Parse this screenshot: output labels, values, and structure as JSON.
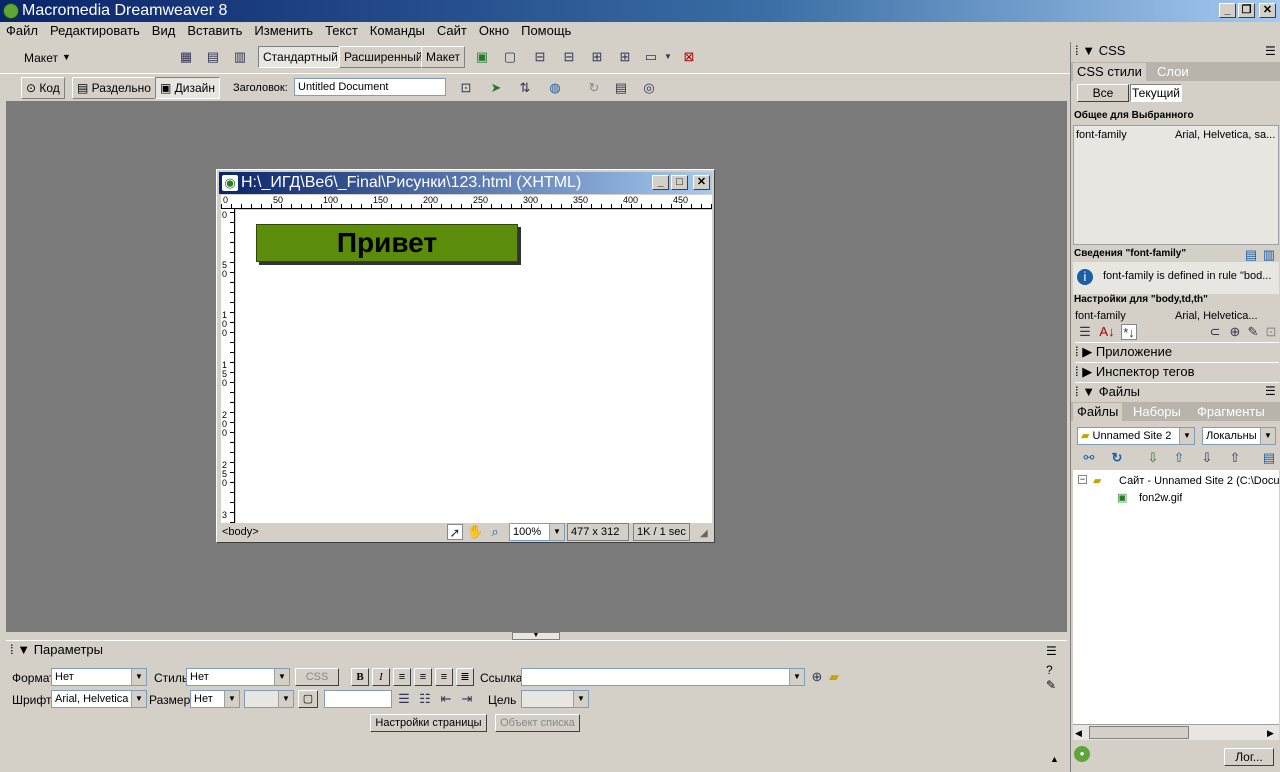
{
  "window": {
    "title": "Macromedia Dreamweaver 8"
  },
  "menu": [
    "Файл",
    "Редактировать",
    "Вид",
    "Вставить",
    "Изменить",
    "Текст",
    "Команды",
    "Сайт",
    "Окно",
    "Помощь"
  ],
  "toolbar": {
    "category": "Макет",
    "modes": [
      "Стандартный",
      "Расширенный",
      "Макет"
    ]
  },
  "docbar": {
    "views": [
      "Код",
      "Раздельно",
      "Дизайн"
    ],
    "title_label": "Заголовок:",
    "title_value": "Untitled Document"
  },
  "document": {
    "window_title": "H:\\_ИГД\\Веб\\_Final\\Рисунки\\123.html (XHTML)",
    "ruler_h": [
      "0",
      "50",
      "100",
      "150",
      "200",
      "250",
      "300",
      "350",
      "400",
      "450"
    ],
    "ruler_v": [
      "0",
      "5\n0",
      "1\n0\n0",
      "1\n5\n0",
      "2\n0\n0",
      "2\n5\n0",
      "3"
    ],
    "heading": "Привет",
    "status": {
      "tag": "<body>",
      "zoom": "100%",
      "size": "477 x 312",
      "download": "1K / 1 sec"
    }
  },
  "properties": {
    "title": "Параметры",
    "format_label": "Формат",
    "format_value": "Нет",
    "style_label": "Стиль",
    "style_value": "Нет",
    "css_button": "CSS",
    "link_label": "Ссылка",
    "font_label": "Шрифт",
    "font_value": "Arial, Helvetica",
    "size_label": "Размер:",
    "size_value": "Нет",
    "target_label": "Цель",
    "page_settings": "Настройки страницы",
    "list_item": "Объект списка"
  },
  "css_panel": {
    "title": "CSS",
    "tabs": [
      "CSS стили",
      "Слои"
    ],
    "mode_buttons": [
      "Все",
      "Текущий"
    ],
    "summary_header": "Общее для Выбранного",
    "summary_prop": "font-family",
    "summary_value": "Arial, Helvetica, sa...",
    "info_header": "Сведения \"font-family\"",
    "info_text": "font-family is defined in rule \"bod...",
    "rule_header": "Настройки для \"body,td,th\"",
    "rule_prop": "font-family",
    "rule_value": "Arial, Helvetica..."
  },
  "collapsed_panels": [
    "Приложение",
    "Инспектор тегов"
  ],
  "files_panel": {
    "title": "Файлы",
    "tabs": [
      "Файлы",
      "Наборы",
      "Фрагменты"
    ],
    "site": "Unnamed Site 2",
    "view": "Локальны",
    "tree_root": "Сайт - Unnamed Site 2 (C:\\Docur",
    "tree_child": "fon2w.gif",
    "log_button": "Лог..."
  }
}
